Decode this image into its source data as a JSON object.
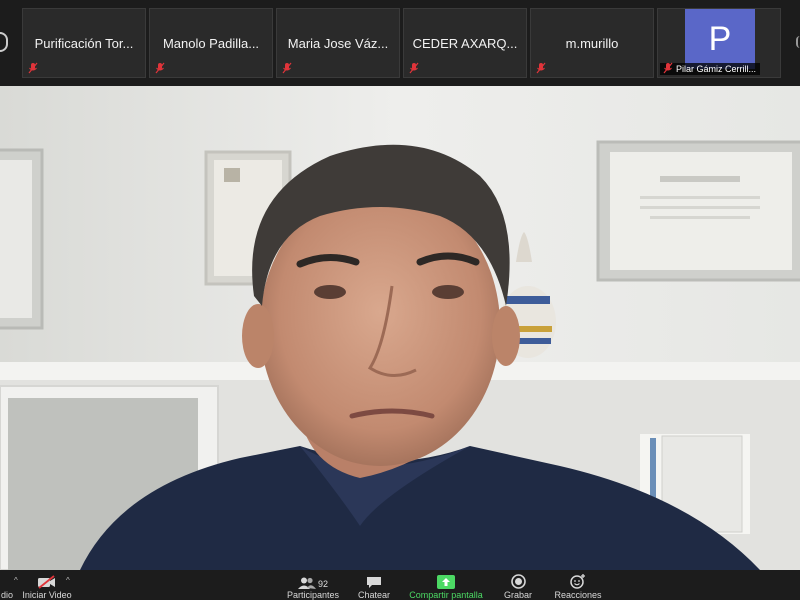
{
  "participants": [
    {
      "name": "Purificación Tor..."
    },
    {
      "name": "Manolo Padilla..."
    },
    {
      "name": "Maria Jose Váz..."
    },
    {
      "name": "CEDER AXARQ..."
    },
    {
      "name": "m.murillo"
    },
    {
      "name": "Pilar Gámiz Cerrill...",
      "initial": "P"
    }
  ],
  "toolbar": {
    "audio_label": "dio",
    "video_label": "Iniciar Video",
    "participants_label": "Participantes",
    "participants_count": "92",
    "chat_label": "Chatear",
    "share_label": "Compartir pantalla",
    "record_label": "Grabar",
    "reactions_label": "Reacciones"
  },
  "colors": {
    "share_accent": "#4cd964",
    "avatar_bg": "#5a67c8",
    "muted_red": "#e0343a"
  },
  "icons": [
    "mic-muted-icon",
    "video-off-icon",
    "participants-icon",
    "chat-icon",
    "share-screen-icon",
    "record-icon",
    "reactions-icon"
  ]
}
